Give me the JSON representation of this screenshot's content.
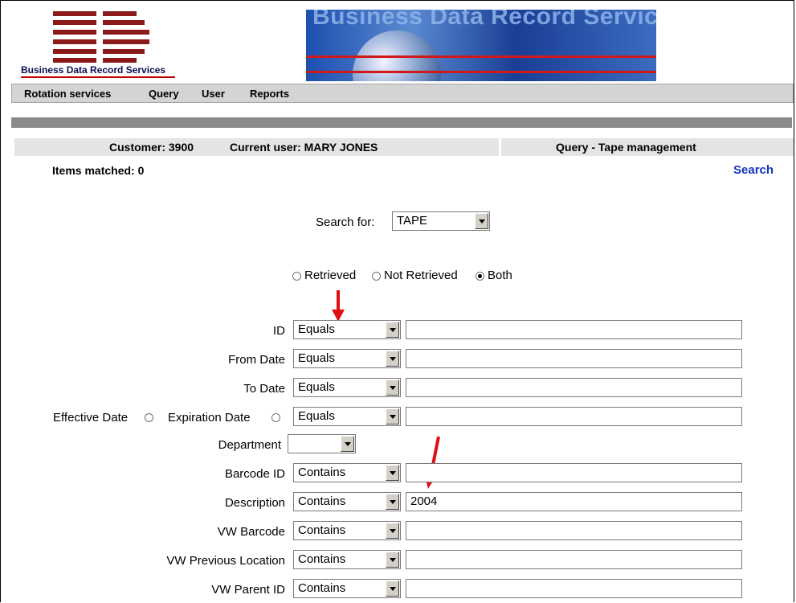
{
  "logo": {
    "text": "Business Data Record Services"
  },
  "banner": {
    "title": "Business Data Record Services"
  },
  "nav": {
    "items": [
      "Rotation services",
      "Query",
      "User",
      "Reports"
    ]
  },
  "info": {
    "customer": "Customer: 3900",
    "current_user": "Current user: MARY JONES",
    "page_title": "Query - Tape management",
    "items_matched": "Items matched: 0",
    "search_link": "Search"
  },
  "search_for": {
    "label": "Search for:",
    "value": "TAPE"
  },
  "retrieval": {
    "options": [
      "Retrieved",
      "Not Retrieved",
      "Both"
    ],
    "selected": "Both"
  },
  "fields": {
    "id": {
      "label": "ID",
      "operator": "Equals",
      "value": ""
    },
    "from_date": {
      "label": "From Date",
      "operator": "Equals",
      "value": ""
    },
    "to_date": {
      "label": "To Date",
      "operator": "Equals",
      "value": ""
    },
    "effective_label": "Effective Date",
    "expiration_label": "Expiration Date",
    "date_type": {
      "operator": "Equals",
      "value": ""
    },
    "department": {
      "label": "Department",
      "value": ""
    },
    "barcode_id": {
      "label": "Barcode ID",
      "operator": "Contains",
      "value": ""
    },
    "description": {
      "label": "Description",
      "operator": "Contains",
      "value": "2004"
    },
    "vw_barcode": {
      "label": "VW Barcode",
      "operator": "Contains",
      "value": ""
    },
    "vw_previous_location": {
      "label": "VW Previous Location",
      "operator": "Contains",
      "value": ""
    },
    "vw_parent_id": {
      "label": "VW Parent ID",
      "operator": "Contains",
      "value": ""
    }
  },
  "colors": {
    "link": "#1533c2",
    "arrow": "#e01010",
    "nav_bg": "#d4d4d4",
    "info_bg": "#e4e4e4"
  }
}
